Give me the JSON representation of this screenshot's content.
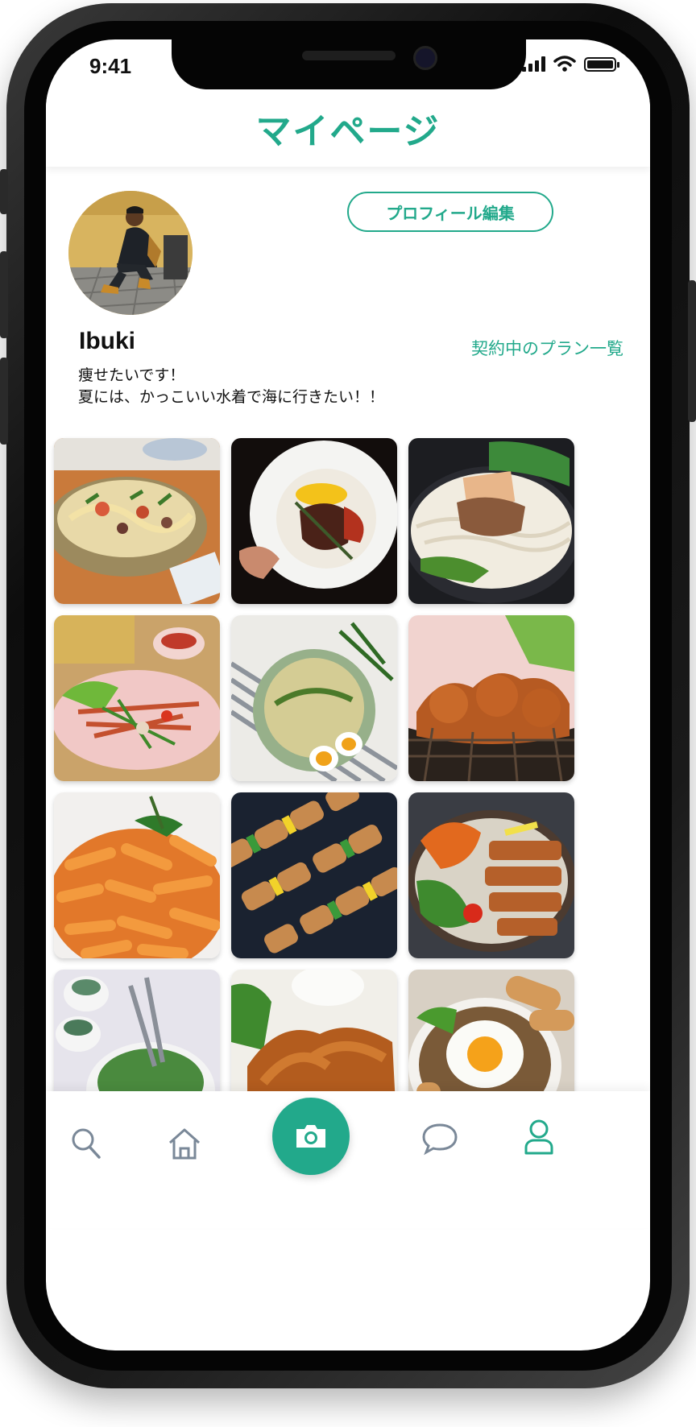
{
  "status_bar": {
    "time": "9:41"
  },
  "header": {
    "title": "マイページ"
  },
  "profile": {
    "edit_button": "プロフィール編集",
    "username": "Ibuki",
    "plans_link": "契約中のプラン一覧",
    "bio_lines": [
      "痩せたいです！",
      "夏には、かっこいい水着で海に行きたい！！"
    ]
  },
  "posts": [
    {
      "icon": "seafood-spaghetti-photo"
    },
    {
      "icon": "steak-plate-photo"
    },
    {
      "icon": "beef-noodle-bowl-photo"
    },
    {
      "icon": "papaya-salad-photo"
    },
    {
      "icon": "quinoa-salad-egg-photo"
    },
    {
      "icon": "fried-chicken-basket-photo"
    },
    {
      "icon": "penne-pasta-photo"
    },
    {
      "icon": "chicken-skewers-photo"
    },
    {
      "icon": "grilled-pork-salad-photo"
    },
    {
      "icon": "green-salad-bowl-photo"
    },
    {
      "icon": "fried-cutlet-photo"
    },
    {
      "icon": "fried-egg-rice-bowl-photo"
    }
  ],
  "nav": [
    {
      "icon": "search-icon"
    },
    {
      "icon": "home-icon"
    },
    {
      "icon": "camera-icon"
    },
    {
      "icon": "chat-icon"
    },
    {
      "icon": "profile-icon"
    }
  ],
  "colors": {
    "accent": "#22a98b",
    "text": "#111111",
    "nav_icon": "#7a8898"
  }
}
